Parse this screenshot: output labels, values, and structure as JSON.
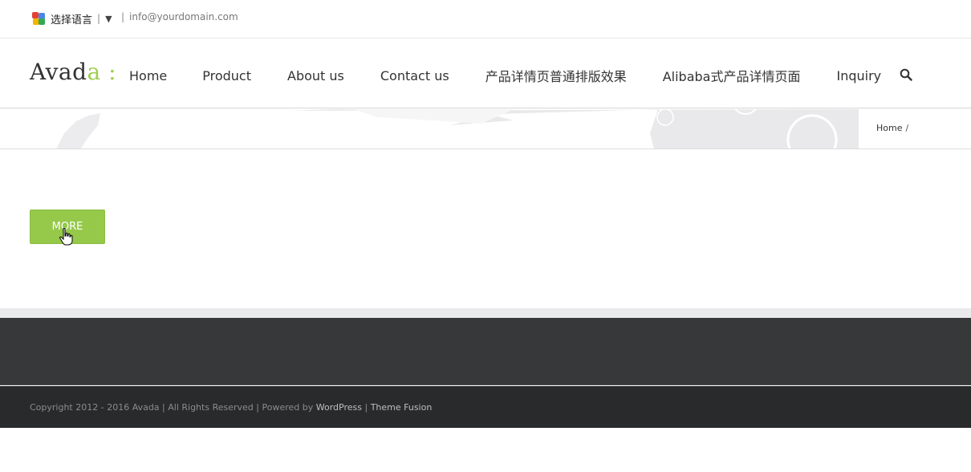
{
  "topbar": {
    "language_label": "选择语言",
    "language_arrow": "▼",
    "email": "info@yourdomain.com"
  },
  "header": {
    "logo_main": "Avad",
    "logo_accent": "a :",
    "nav": [
      {
        "label": "Home"
      },
      {
        "label": "Product"
      },
      {
        "label": "About us"
      },
      {
        "label": "Contact us"
      },
      {
        "label": "产品详情页普通排版效果"
      },
      {
        "label": "Alibaba式产品详情页面"
      },
      {
        "label": "Inquiry"
      }
    ],
    "search_icon": "search-icon"
  },
  "breadcrumb": {
    "home": "Home",
    "separator": "/"
  },
  "content": {
    "more_button": "MORE"
  },
  "footer": {
    "copyright_prefix": "Copyright 2012 - 2016 Avada | All Rights Reserved | Powered by",
    "wordpress_link": "WordPress",
    "divider": "|",
    "theme_link": "Theme Fusion"
  },
  "colors": {
    "accent": "#a0ce4e",
    "button": "#96c94a",
    "footer_bg": "#363839",
    "copyright_bg": "#282a2b"
  }
}
